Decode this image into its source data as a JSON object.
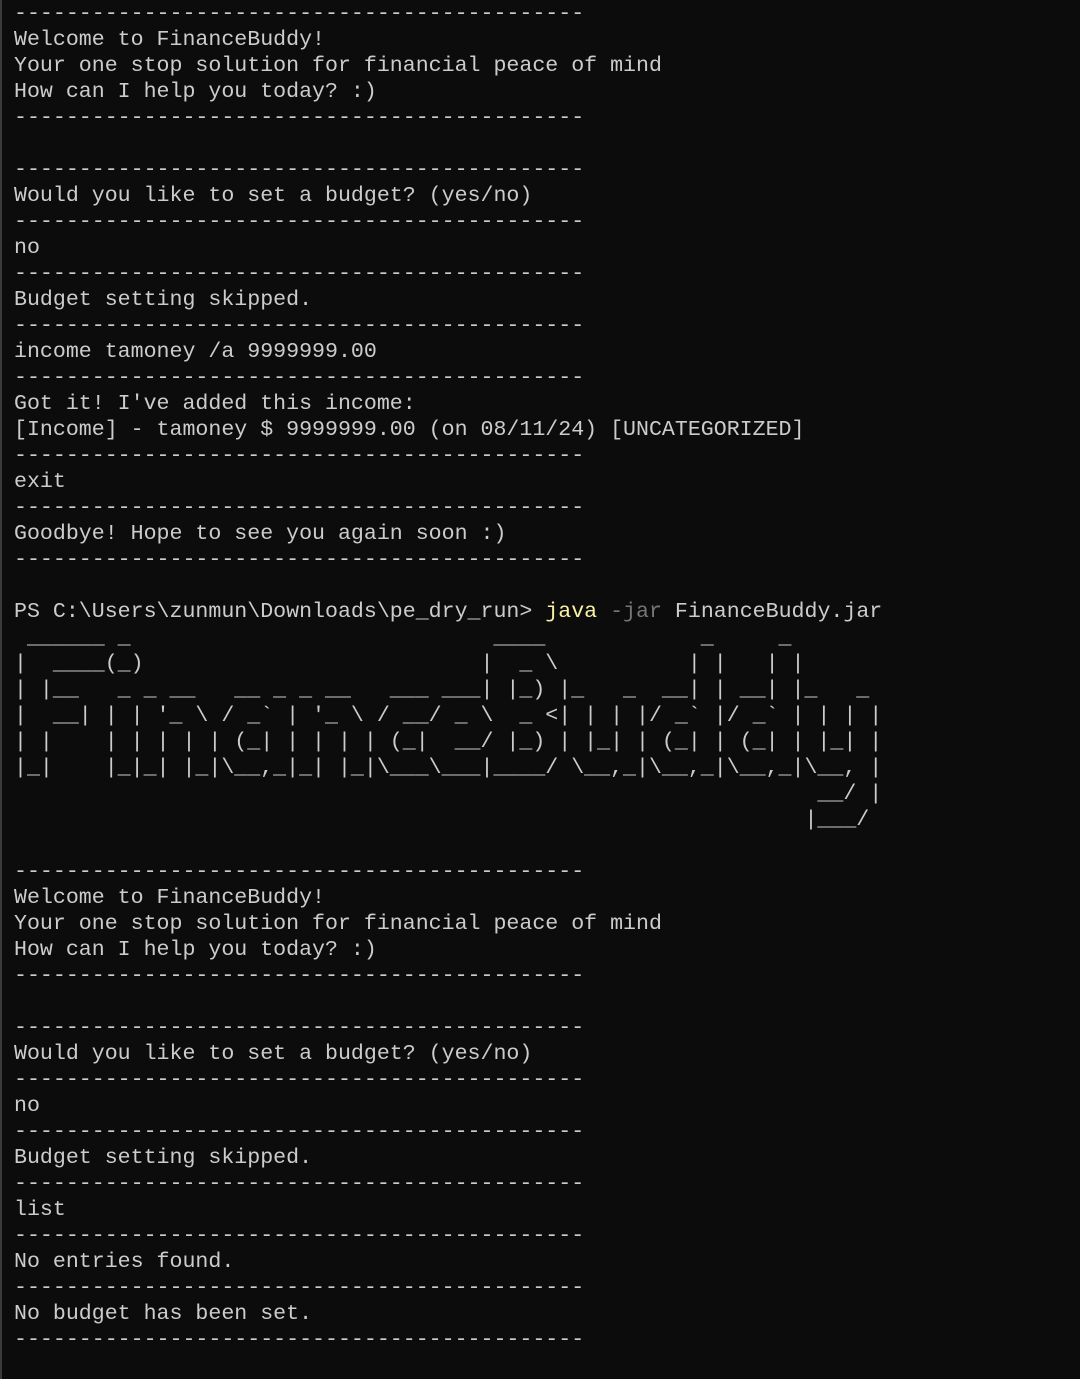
{
  "colors": {
    "background": "#0c0c0c",
    "text": "#cccccc",
    "command": "#f9f1a5",
    "parameter": "#767676"
  },
  "session1": {
    "separator_top": "--------------------------------------------",
    "welcome": "Welcome to FinanceBuddy!",
    "tagline": "Your one stop solution for financial peace of mind",
    "help": "How can I help you today? :)",
    "separator_after_welcome": "--------------------------------------------",
    "separator_before_budget": "--------------------------------------------",
    "budget_prompt": "Would you like to set a budget? (yes/no)",
    "separator_after_budget_prompt": "--------------------------------------------",
    "input_no": "no",
    "separator_after_no": "--------------------------------------------",
    "budget_skipped": "Budget setting skipped.",
    "separator_after_skipped": "--------------------------------------------",
    "input_income": "income tamoney /a 9999999.00",
    "separator_after_income_input": "--------------------------------------------",
    "income_added": "Got it! I've added this income:",
    "income_entry": "[Income] - tamoney $ 9999999.00 (on 08/11/24) [UNCATEGORIZED]",
    "separator_after_income": "--------------------------------------------",
    "input_exit": "exit",
    "separator_after_exit": "--------------------------------------------",
    "goodbye": "Goodbye! Hope to see you again soon :)",
    "separator_end": "--------------------------------------------"
  },
  "prompt": {
    "path": "PS C:\\Users\\zunmun\\Downloads\\pe_dry_run> ",
    "command": "java",
    "parameter": " -jar",
    "argument": " FinanceBuddy.jar"
  },
  "logo_ascii": " ______ _                            ____            _     _\n|  ____(_)                          |  _ \\          | |   | |\n| |__   _ _ __   __ _ _ __   ___ ___| |_) |_   _  __| | __| |_   _\n|  __| | | '_ \\ / _` | '_ \\ / __/ _ \\  _ <| | | |/ _` |/ _` | | | |\n| |    | | | | | (_| | | | | (_|  __/ |_) | |_| | (_| | (_| | |_| |\n|_|    |_|_| |_|\\__,_|_| |_|\\___\\___|____/ \\__,_|\\__,_|\\__,_|\\__, |\n                                                              __/ |\n                                                             |___/",
  "session2": {
    "separator_top": "--------------------------------------------",
    "welcome": "Welcome to FinanceBuddy!",
    "tagline": "Your one stop solution for financial peace of mind",
    "help": "How can I help you today? :)",
    "separator_after_welcome": "--------------------------------------------",
    "separator_before_budget": "--------------------------------------------",
    "budget_prompt": "Would you like to set a budget? (yes/no)",
    "separator_after_budget_prompt": "--------------------------------------------",
    "input_no": "no",
    "separator_after_no": "--------------------------------------------",
    "budget_skipped": "Budget setting skipped.",
    "separator_after_skipped": "--------------------------------------------",
    "input_list": "list",
    "separator_after_list": "--------------------------------------------",
    "no_entries": "No entries found.",
    "separator_after_no_entries": "--------------------------------------------",
    "no_budget": "No budget has been set.",
    "separator_end": "--------------------------------------------"
  }
}
